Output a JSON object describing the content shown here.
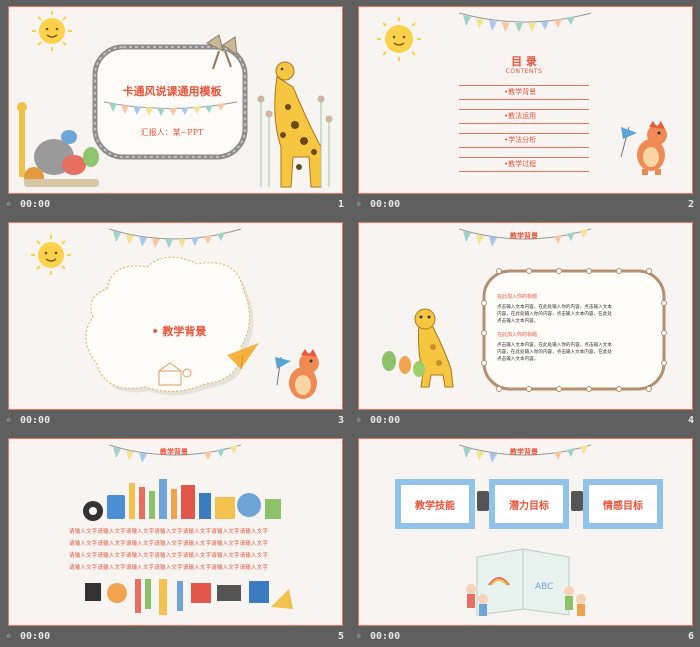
{
  "slides": [
    {
      "number": "1",
      "time": "00:00",
      "title": "卡通风说课通用模板",
      "subtitle": "汇报人：某~PPT"
    },
    {
      "number": "2",
      "time": "00:00",
      "title": "目 录",
      "subtitle": "CONTENTS",
      "items": [
        "•教学背景",
        "•教法运用",
        "•学法分析",
        "•教学过程"
      ]
    },
    {
      "number": "3",
      "time": "00:00",
      "title": "• 教学背景"
    },
    {
      "number": "4",
      "time": "00:00",
      "title": "教学背景",
      "paragraphs": [
        {
          "heading": "在此加入你的标题",
          "lines": [
            "点击输入文本内容，在此处输入你的内容，点击输入文本",
            "内容，在此处输入你的内容，点击输入文本内容，在此处",
            "点击输入文本内容。"
          ]
        },
        {
          "heading": "在此加入你的标题",
          "lines": [
            "点击输入文本内容，在此处输入你的内容，点击输入文本",
            "内容，在此处输入你的内容，点击输入文本内容，在此处",
            "点击输入文本内容。"
          ]
        }
      ]
    },
    {
      "number": "5",
      "time": "00:00",
      "title": "教学背景",
      "lines": [
        "请输入文字请输入文字请输入文字请输入文字请输入文字请输入文字请输入文字",
        "请输入文字请输入文字请输入文字请输入文字请输入文字请输入文字请输入文字",
        "请输入文字请输入文字请输入文字请输入文字请输入文字请输入文字请输入文字",
        "请输入文字请输入文字请输入文字请输入文字请输入文字请输入文字请输入文字"
      ]
    },
    {
      "number": "6",
      "time": "00:00",
      "title": "教学背景",
      "boxes": [
        "教学技能",
        "潜力目标",
        "情感目标"
      ]
    }
  ],
  "star": "☆",
  "colors": {
    "accent": "#e8553b",
    "border": "#e7745e",
    "background": "#5f5f5f",
    "slide_bg": "#f7f4f1"
  }
}
